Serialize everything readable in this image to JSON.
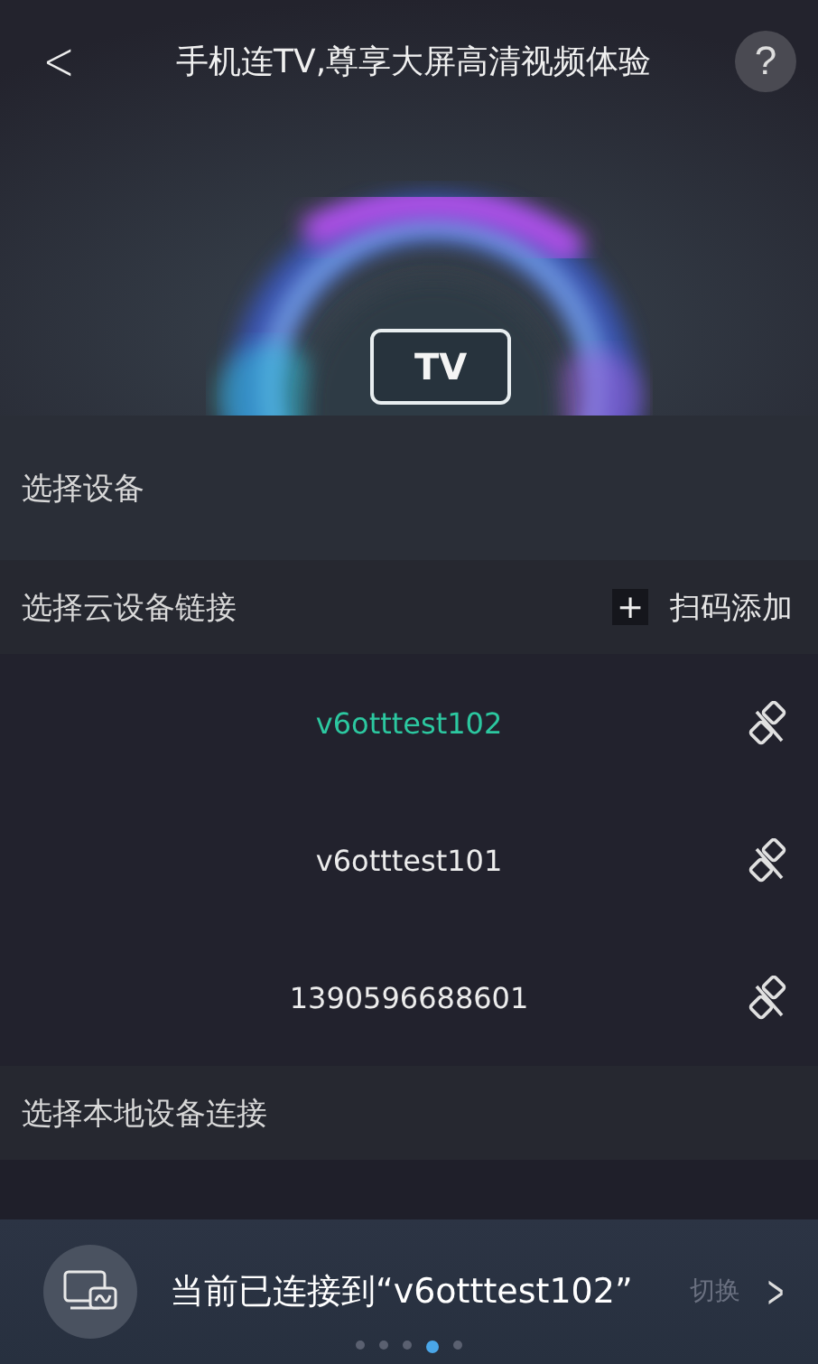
{
  "header": {
    "title": "手机连TV,尊享大屏高清视频体验",
    "back": "<",
    "help": "?",
    "tv_badge": "TV"
  },
  "device_section": {
    "title": "选择设备"
  },
  "cloud_section": {
    "title": "选择云设备链接",
    "add_icon": "+",
    "add_label": "扫码添加"
  },
  "devices": [
    {
      "name": "v6otttest102",
      "selected": true
    },
    {
      "name": "v6otttest101",
      "selected": false
    },
    {
      "name": "1390596688601",
      "selected": false
    }
  ],
  "local_section": {
    "title": "选择本地设备连接"
  },
  "banner": {
    "text": "当前已连接到“v6otttest102”",
    "action": "切换",
    "arrow": ">",
    "pages": [
      {
        "selected": false
      },
      {
        "selected": false
      },
      {
        "selected": false
      },
      {
        "selected": true
      },
      {
        "selected": false
      }
    ]
  }
}
